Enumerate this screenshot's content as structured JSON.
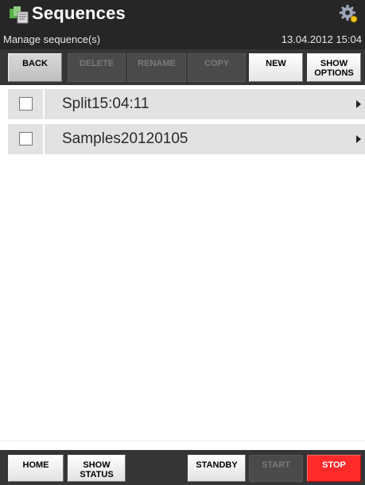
{
  "header": {
    "title": "Sequences",
    "subtitle": "Manage sequence(s)",
    "datetime": "13.04.2012 15:04",
    "app_icon": "sequences-icon",
    "settings_icon": "gear-icon"
  },
  "toolbar": {
    "back": "BACK",
    "delete": "DELETE",
    "rename": "RENAME",
    "copy": "COPY",
    "new": "NEW",
    "show_options_line1": "SHOW",
    "show_options_line2": "OPTIONS"
  },
  "sequences": [
    {
      "name": "Split15:04:11",
      "checked": false
    },
    {
      "name": "Samples20120105",
      "checked": false
    }
  ],
  "footer": {
    "home": "HOME",
    "show_status_line1": "SHOW",
    "show_status_line2": "STATUS",
    "standby": "STANDBY",
    "start": "START",
    "stop": "STOP"
  },
  "colors": {
    "header_bg": "#262626",
    "toolbar_bg": "#353535",
    "row_bg": "#e2e2e2",
    "stop_red": "#ff2a2a"
  }
}
